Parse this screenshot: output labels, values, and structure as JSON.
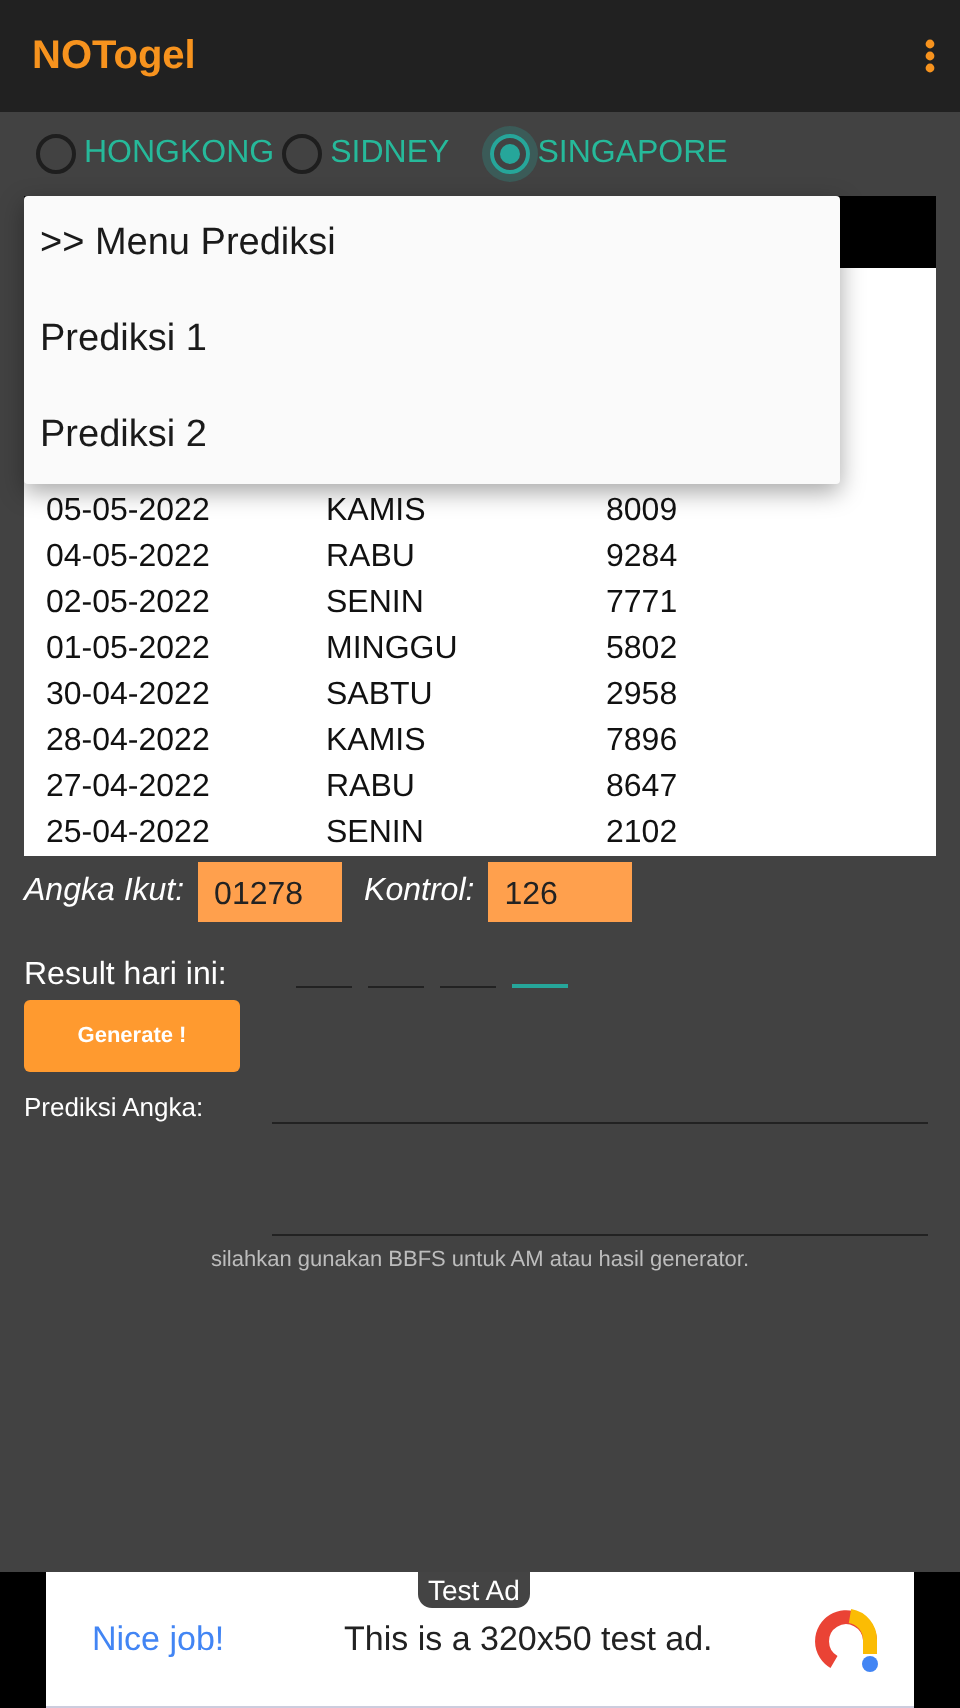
{
  "app_bar": {
    "title": "NOTogel"
  },
  "markets": [
    {
      "label": "HONGKONG",
      "selected": false
    },
    {
      "label": "SIDNEY",
      "selected": false
    },
    {
      "label": "SINGAPORE",
      "selected": true
    }
  ],
  "results_table": {
    "rows": [
      {
        "date": "05-05-2022",
        "day": "KAMIS",
        "number": "8009"
      },
      {
        "date": "04-05-2022",
        "day": "RABU",
        "number": "9284"
      },
      {
        "date": "02-05-2022",
        "day": "SENIN",
        "number": "7771"
      },
      {
        "date": "01-05-2022",
        "day": "MINGGU",
        "number": "5802"
      },
      {
        "date": "30-04-2022",
        "day": "SABTU",
        "number": "2958"
      },
      {
        "date": "28-04-2022",
        "day": "KAMIS",
        "number": "7896"
      },
      {
        "date": "27-04-2022",
        "day": "RABU",
        "number": "8647"
      },
      {
        "date": "25-04-2022",
        "day": "SENIN",
        "number": "2102"
      }
    ]
  },
  "menu": {
    "items": [
      ">> Menu Prediksi",
      "Prediksi 1",
      "Prediksi 2"
    ]
  },
  "inputs": [
    {
      "label": "Angka Ikut:",
      "value": "01278"
    },
    {
      "label": "Kontrol:",
      "value": "126"
    }
  ],
  "result_today": {
    "label": "Result hari ini:",
    "digits": [
      {
        "focused": false
      },
      {
        "focused": false
      },
      {
        "focused": false
      },
      {
        "focused": true
      }
    ]
  },
  "generate_button": "Generate !",
  "prediction": {
    "label": "Prediksi Angka:"
  },
  "hint": "silahkan gunakan BBFS untuk AM atau hasil generator.",
  "ad": {
    "badge": "Test Ad",
    "headline": "Nice job!",
    "text": "This is a 320x50 test ad."
  }
}
